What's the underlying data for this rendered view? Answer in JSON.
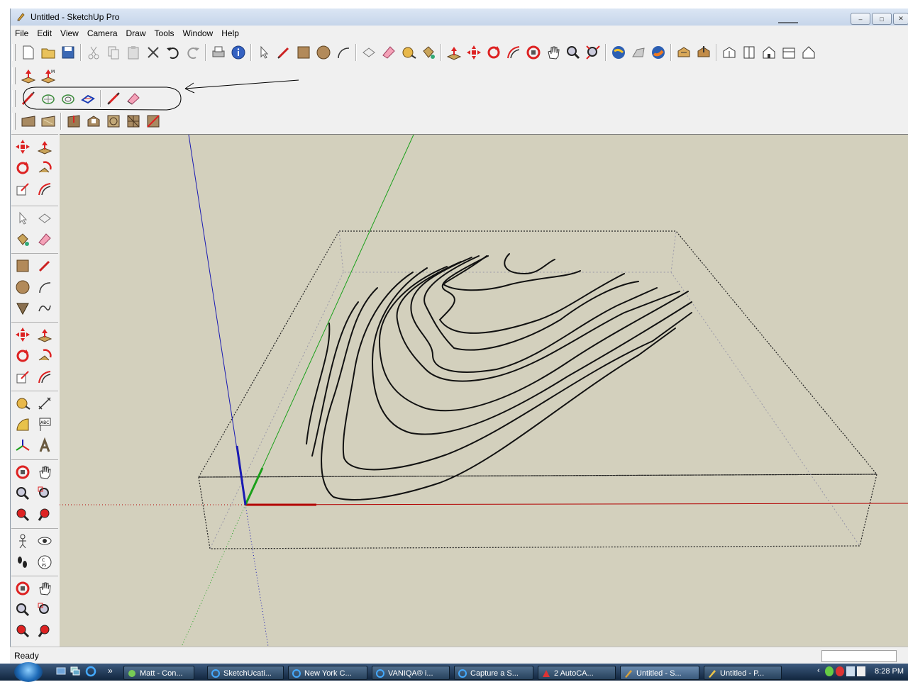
{
  "window": {
    "title": "Untitled - SketchUp Pro",
    "minimize": "–",
    "maximize": "□",
    "close": "✕"
  },
  "menu": [
    "File",
    "Edit",
    "View",
    "Camera",
    "Draw",
    "Tools",
    "Window",
    "Help"
  ],
  "status": {
    "text": "Ready",
    "vcb_value": ""
  },
  "taskbar": {
    "tasks": [
      {
        "label": "Matt - Con..."
      },
      {
        "label": "SketchUcati..."
      },
      {
        "label": "New York C..."
      },
      {
        "label": "VANIQA® i..."
      },
      {
        "label": "Capture a S..."
      },
      {
        "label": "2 AutoCA..."
      },
      {
        "label": "Untitled - S..."
      },
      {
        "label": "Untitled - P..."
      }
    ],
    "overflow": "»",
    "clock": "8:28 PM"
  },
  "colors": {
    "viewport": "#d3d0bd",
    "axis_red": "#b30000",
    "axis_green": "#1aa01a",
    "axis_blue": "#1a1ab3"
  }
}
